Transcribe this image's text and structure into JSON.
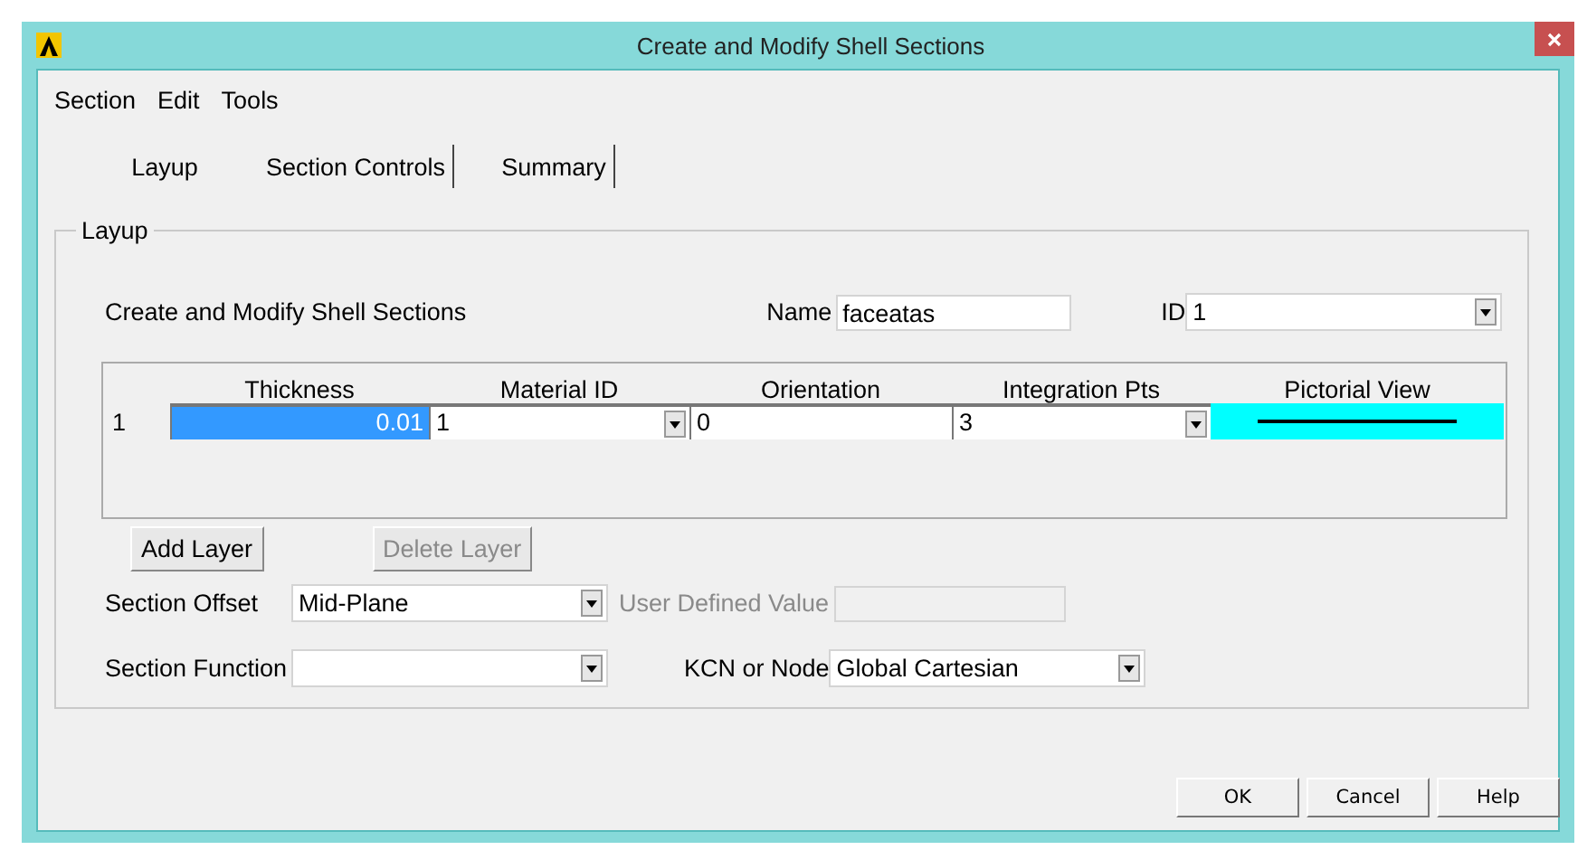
{
  "window": {
    "title": "Create and Modify Shell Sections"
  },
  "menu": [
    "Section",
    "Edit",
    "Tools"
  ],
  "tabs": [
    {
      "label": "Layup",
      "selected": true
    },
    {
      "label": "Section Controls",
      "selected": false
    },
    {
      "label": "Summary",
      "selected": false
    }
  ],
  "group": {
    "title": "Layup"
  },
  "heading": "Create and Modify Shell Sections",
  "name": {
    "label": "Name",
    "value": "faceatas"
  },
  "id": {
    "label": "ID",
    "value": "1"
  },
  "layers": {
    "columns": [
      "Thickness",
      "Material ID",
      "Orientation",
      "Integration Pts",
      "Pictorial View"
    ],
    "rows": [
      {
        "number": "1",
        "thickness": "0.01",
        "selected": true,
        "material_id": "1",
        "orientation": "0",
        "integration_pts": "3"
      }
    ]
  },
  "buttons": [
    {
      "label": "Add Layer",
      "disabled": false
    },
    {
      "label": "Delete Layer",
      "disabled": true
    }
  ],
  "section_offset": {
    "label": "Section Offset",
    "value": "Mid-Plane"
  },
  "user_defined": {
    "label": "User Defined Value",
    "disabled": true
  },
  "section_function": {
    "label": "Section Function"
  },
  "kcn": {
    "label": "KCN or Node",
    "value": "Global Cartesian"
  },
  "footer_buttons": [
    "OK",
    "Cancel",
    "Help"
  ]
}
